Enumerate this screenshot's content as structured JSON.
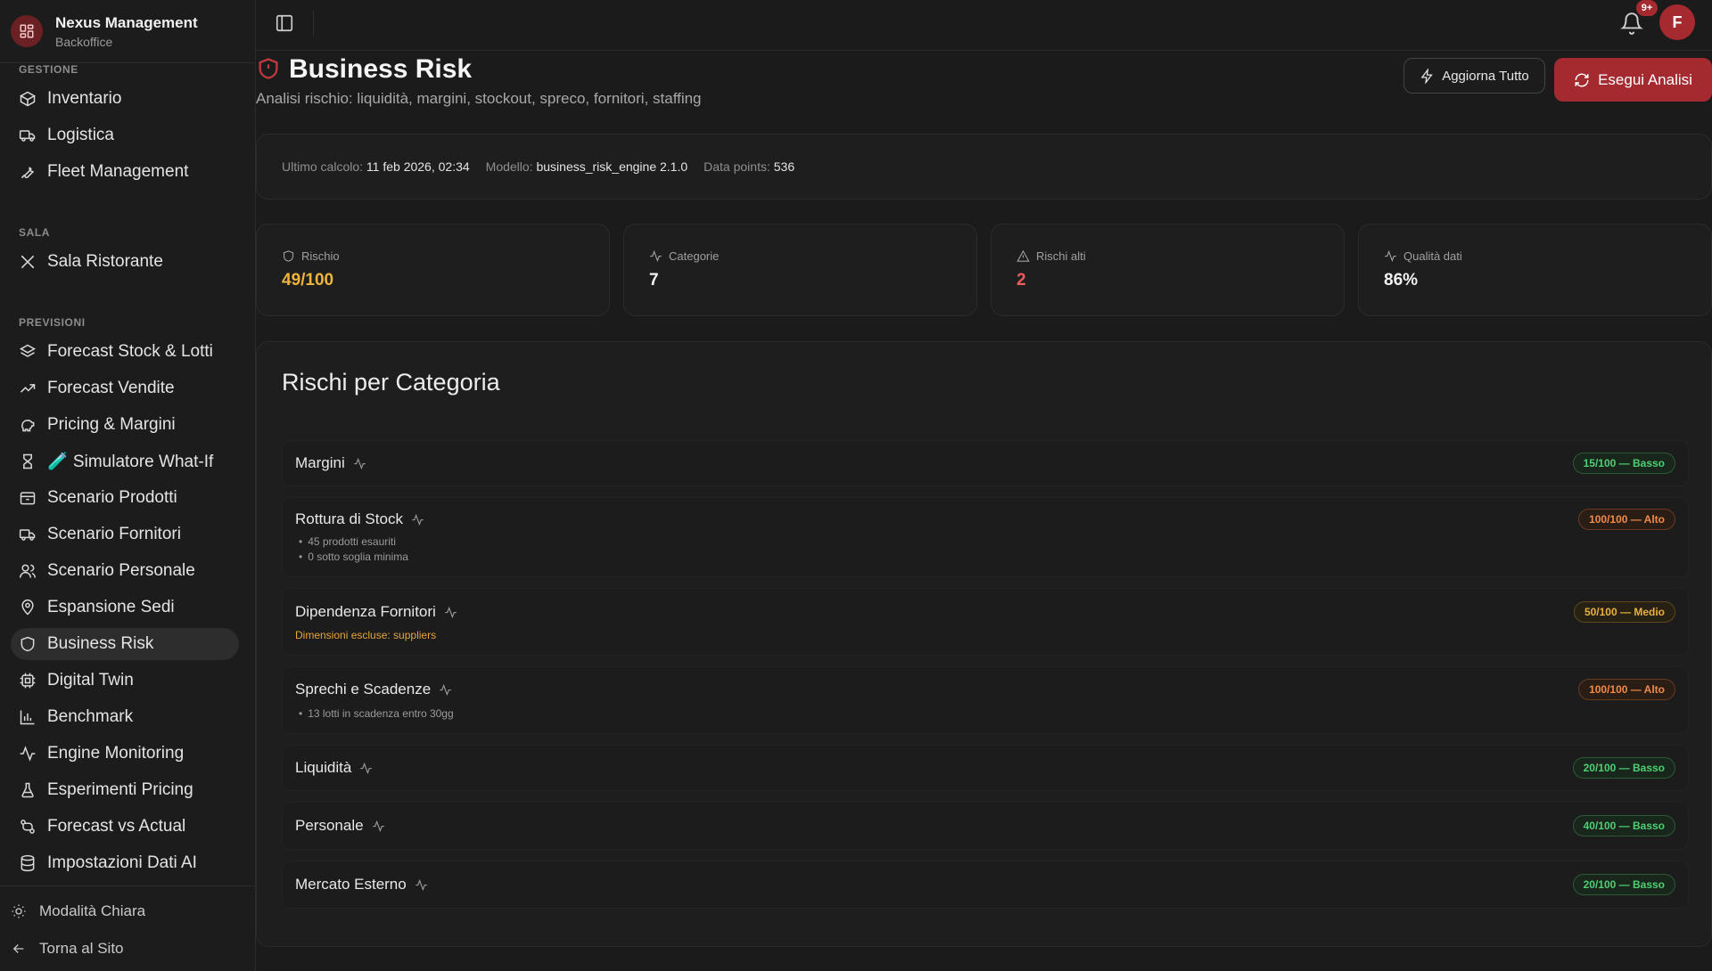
{
  "app": {
    "title": "Nexus Management",
    "subtitle": "Backoffice"
  },
  "sidebar": {
    "sections": {
      "gestione": "GESTIONE",
      "sala": "SALA",
      "previsioni": "PREVISIONI"
    },
    "items": [
      {
        "label": "Inventario",
        "icon": "box-icon"
      },
      {
        "label": "Logistica",
        "icon": "truck-icon"
      },
      {
        "label": "Fleet Management",
        "icon": "wrench-icon"
      },
      {
        "label": "Sala Ristorante",
        "icon": "utensils-icon"
      },
      {
        "label": "Forecast Stock & Lotti",
        "icon": "layers-icon"
      },
      {
        "label": "Forecast Vendite",
        "icon": "trending-up-icon"
      },
      {
        "label": "Pricing & Margini",
        "icon": "piggy-bank-icon"
      },
      {
        "label": "🧪 Simulatore What-If",
        "icon": "hourglass-icon"
      },
      {
        "label": "Scenario Prodotti",
        "icon": "package-icon"
      },
      {
        "label": "Scenario Fornitori",
        "icon": "truck-icon"
      },
      {
        "label": "Scenario Personale",
        "icon": "users-icon"
      },
      {
        "label": "Espansione Sedi",
        "icon": "map-pin-icon"
      },
      {
        "label": "Business Risk",
        "icon": "shield-icon",
        "active": true
      },
      {
        "label": "Digital Twin",
        "icon": "cpu-icon"
      },
      {
        "label": "Benchmark",
        "icon": "bar-chart-icon"
      },
      {
        "label": "Engine Monitoring",
        "icon": "activity-icon"
      },
      {
        "label": "Esperimenti Pricing",
        "icon": "flask-icon"
      },
      {
        "label": "Forecast vs Actual",
        "icon": "git-compare-icon"
      },
      {
        "label": "Impostazioni Dati AI",
        "icon": "database-icon"
      }
    ],
    "footer": {
      "theme": "Modalità Chiara",
      "back": "Torna al Sito"
    }
  },
  "topbar": {
    "notifications_badge": "9+",
    "avatar_initial": "F"
  },
  "page": {
    "title": "Business Risk",
    "subtitle": "Analisi rischio: liquidità, margini, stockout, spreco, fornitori, staffing",
    "btn_refresh": "Aggiorna Tutto",
    "btn_run": "Esegui Analisi"
  },
  "meta": {
    "last_calc_label": "Ultimo calcolo:",
    "last_calc_value": "11 feb 2026, 02:34",
    "model_label": "Modello:",
    "model_value": "business_risk_engine 2.1.0",
    "points_label": "Data points:",
    "points_value": "536"
  },
  "stats": [
    {
      "label": "Rischio",
      "value": "49/100",
      "color": "#f0b43c",
      "icon": "shield-icon"
    },
    {
      "label": "Categorie",
      "value": "7",
      "color": "#f2f2f2",
      "icon": "activity-icon"
    },
    {
      "label": "Rischi alti",
      "value": "2",
      "color": "#ef5b5b",
      "icon": "alert-triangle-icon"
    },
    {
      "label": "Qualità dati",
      "value": "86%",
      "color": "#f2f2f2",
      "icon": "activity-icon"
    }
  ],
  "categories": {
    "title": "Rischi per Categoria",
    "rows": [
      {
        "name": "Margini",
        "score": "15/100 — Basso",
        "level": "low",
        "details": []
      },
      {
        "name": "Rottura di Stock",
        "score": "100/100 — Alto",
        "level": "high",
        "details": [
          "45 prodotti esauriti",
          "0 sotto soglia minima"
        ]
      },
      {
        "name": "Dipendenza Fornitori",
        "score": "50/100 — Medio",
        "level": "mid",
        "warning": "Dimensioni escluse: suppliers",
        "details": []
      },
      {
        "name": "Sprechi e Scadenze",
        "score": "100/100 — Alto",
        "level": "high",
        "details": [
          "13 lotti in scadenza entro 30gg"
        ]
      },
      {
        "name": "Liquidità",
        "score": "20/100 — Basso",
        "level": "low",
        "details": []
      },
      {
        "name": "Personale",
        "score": "40/100 — Basso",
        "level": "low",
        "details": []
      },
      {
        "name": "Mercato Esterno",
        "score": "20/100 — Basso",
        "level": "low",
        "details": []
      }
    ]
  },
  "colors": {
    "accent": "#a52a2f",
    "low": "#4fcf73",
    "high": "#f08a48",
    "mid": "#e7b13f"
  }
}
